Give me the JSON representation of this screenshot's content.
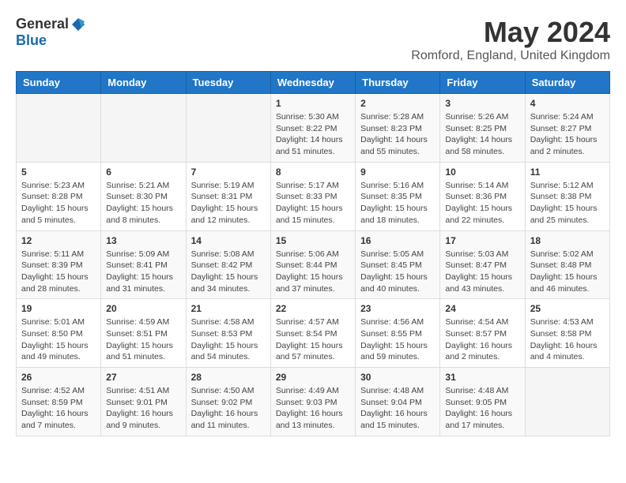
{
  "header": {
    "logo_general": "General",
    "logo_blue": "Blue",
    "month_title": "May 2024",
    "location": "Romford, England, United Kingdom"
  },
  "days_of_week": [
    "Sunday",
    "Monday",
    "Tuesday",
    "Wednesday",
    "Thursday",
    "Friday",
    "Saturday"
  ],
  "weeks": [
    [
      {
        "day": "",
        "content": ""
      },
      {
        "day": "",
        "content": ""
      },
      {
        "day": "",
        "content": ""
      },
      {
        "day": "1",
        "content": "Sunrise: 5:30 AM\nSunset: 8:22 PM\nDaylight: 14 hours\nand 51 minutes."
      },
      {
        "day": "2",
        "content": "Sunrise: 5:28 AM\nSunset: 8:23 PM\nDaylight: 14 hours\nand 55 minutes."
      },
      {
        "day": "3",
        "content": "Sunrise: 5:26 AM\nSunset: 8:25 PM\nDaylight: 14 hours\nand 58 minutes."
      },
      {
        "day": "4",
        "content": "Sunrise: 5:24 AM\nSunset: 8:27 PM\nDaylight: 15 hours\nand 2 minutes."
      }
    ],
    [
      {
        "day": "5",
        "content": "Sunrise: 5:23 AM\nSunset: 8:28 PM\nDaylight: 15 hours\nand 5 minutes."
      },
      {
        "day": "6",
        "content": "Sunrise: 5:21 AM\nSunset: 8:30 PM\nDaylight: 15 hours\nand 8 minutes."
      },
      {
        "day": "7",
        "content": "Sunrise: 5:19 AM\nSunset: 8:31 PM\nDaylight: 15 hours\nand 12 minutes."
      },
      {
        "day": "8",
        "content": "Sunrise: 5:17 AM\nSunset: 8:33 PM\nDaylight: 15 hours\nand 15 minutes."
      },
      {
        "day": "9",
        "content": "Sunrise: 5:16 AM\nSunset: 8:35 PM\nDaylight: 15 hours\nand 18 minutes."
      },
      {
        "day": "10",
        "content": "Sunrise: 5:14 AM\nSunset: 8:36 PM\nDaylight: 15 hours\nand 22 minutes."
      },
      {
        "day": "11",
        "content": "Sunrise: 5:12 AM\nSunset: 8:38 PM\nDaylight: 15 hours\nand 25 minutes."
      }
    ],
    [
      {
        "day": "12",
        "content": "Sunrise: 5:11 AM\nSunset: 8:39 PM\nDaylight: 15 hours\nand 28 minutes."
      },
      {
        "day": "13",
        "content": "Sunrise: 5:09 AM\nSunset: 8:41 PM\nDaylight: 15 hours\nand 31 minutes."
      },
      {
        "day": "14",
        "content": "Sunrise: 5:08 AM\nSunset: 8:42 PM\nDaylight: 15 hours\nand 34 minutes."
      },
      {
        "day": "15",
        "content": "Sunrise: 5:06 AM\nSunset: 8:44 PM\nDaylight: 15 hours\nand 37 minutes."
      },
      {
        "day": "16",
        "content": "Sunrise: 5:05 AM\nSunset: 8:45 PM\nDaylight: 15 hours\nand 40 minutes."
      },
      {
        "day": "17",
        "content": "Sunrise: 5:03 AM\nSunset: 8:47 PM\nDaylight: 15 hours\nand 43 minutes."
      },
      {
        "day": "18",
        "content": "Sunrise: 5:02 AM\nSunset: 8:48 PM\nDaylight: 15 hours\nand 46 minutes."
      }
    ],
    [
      {
        "day": "19",
        "content": "Sunrise: 5:01 AM\nSunset: 8:50 PM\nDaylight: 15 hours\nand 49 minutes."
      },
      {
        "day": "20",
        "content": "Sunrise: 4:59 AM\nSunset: 8:51 PM\nDaylight: 15 hours\nand 51 minutes."
      },
      {
        "day": "21",
        "content": "Sunrise: 4:58 AM\nSunset: 8:53 PM\nDaylight: 15 hours\nand 54 minutes."
      },
      {
        "day": "22",
        "content": "Sunrise: 4:57 AM\nSunset: 8:54 PM\nDaylight: 15 hours\nand 57 minutes."
      },
      {
        "day": "23",
        "content": "Sunrise: 4:56 AM\nSunset: 8:55 PM\nDaylight: 15 hours\nand 59 minutes."
      },
      {
        "day": "24",
        "content": "Sunrise: 4:54 AM\nSunset: 8:57 PM\nDaylight: 16 hours\nand 2 minutes."
      },
      {
        "day": "25",
        "content": "Sunrise: 4:53 AM\nSunset: 8:58 PM\nDaylight: 16 hours\nand 4 minutes."
      }
    ],
    [
      {
        "day": "26",
        "content": "Sunrise: 4:52 AM\nSunset: 8:59 PM\nDaylight: 16 hours\nand 7 minutes."
      },
      {
        "day": "27",
        "content": "Sunrise: 4:51 AM\nSunset: 9:01 PM\nDaylight: 16 hours\nand 9 minutes."
      },
      {
        "day": "28",
        "content": "Sunrise: 4:50 AM\nSunset: 9:02 PM\nDaylight: 16 hours\nand 11 minutes."
      },
      {
        "day": "29",
        "content": "Sunrise: 4:49 AM\nSunset: 9:03 PM\nDaylight: 16 hours\nand 13 minutes."
      },
      {
        "day": "30",
        "content": "Sunrise: 4:48 AM\nSunset: 9:04 PM\nDaylight: 16 hours\nand 15 minutes."
      },
      {
        "day": "31",
        "content": "Sunrise: 4:48 AM\nSunset: 9:05 PM\nDaylight: 16 hours\nand 17 minutes."
      },
      {
        "day": "",
        "content": ""
      }
    ]
  ]
}
